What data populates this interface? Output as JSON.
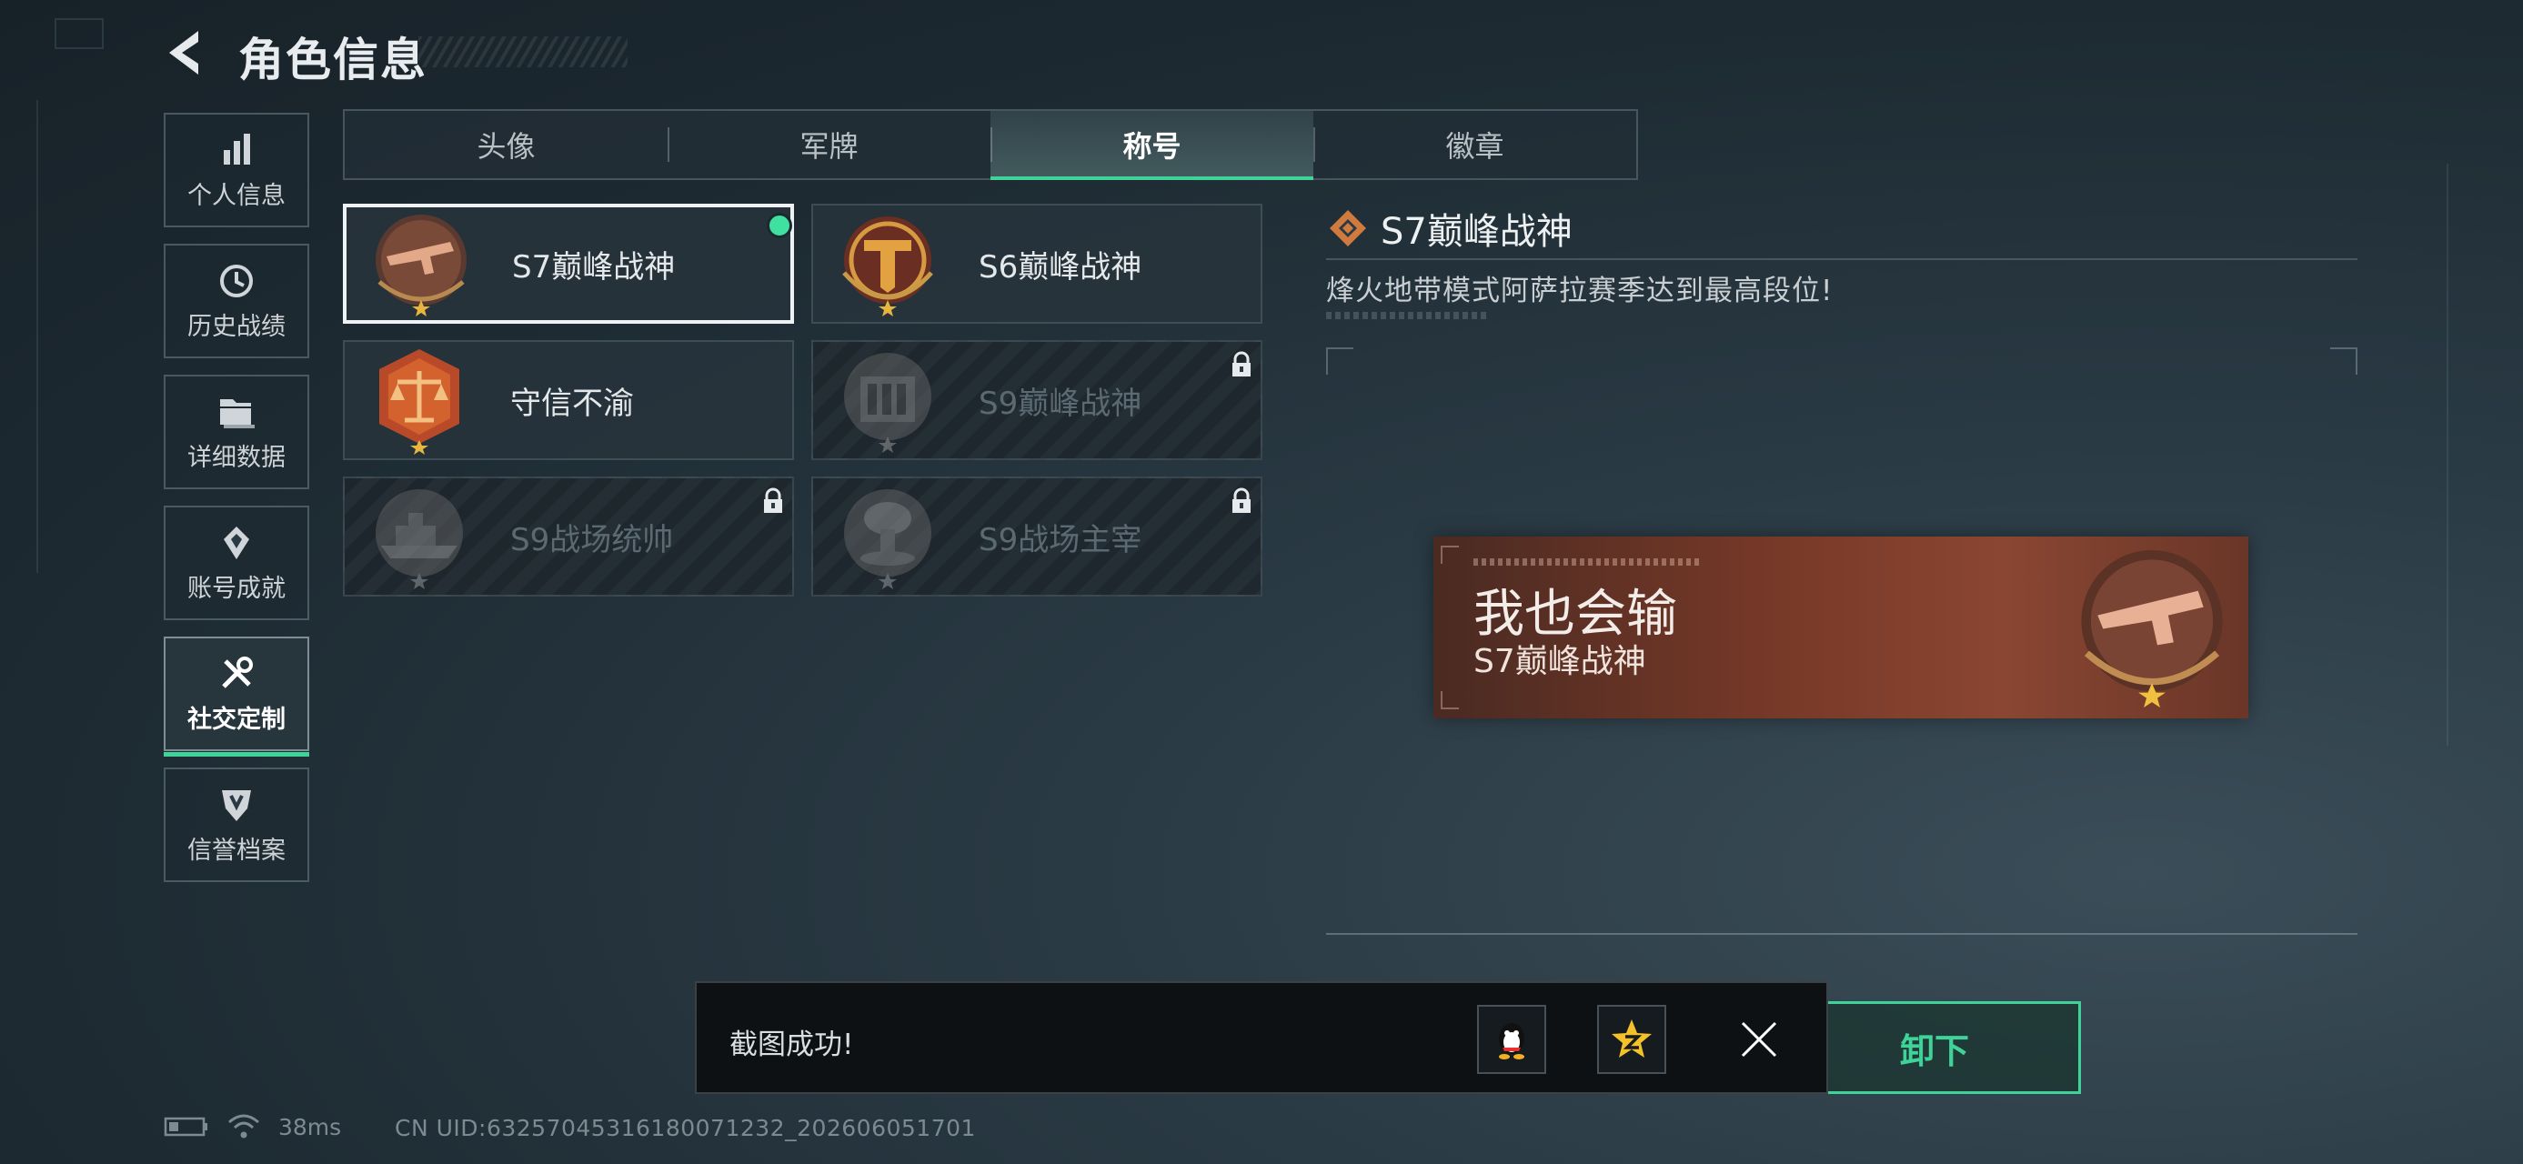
{
  "header": {
    "title": "角色信息"
  },
  "sidebar": {
    "items": [
      {
        "label": "个人信息",
        "icon": "bar-chart-icon"
      },
      {
        "label": "历史战绩",
        "icon": "history-clock-icon"
      },
      {
        "label": "详细数据",
        "icon": "folder-icon"
      },
      {
        "label": "账号成就",
        "icon": "achievement-icon"
      },
      {
        "label": "社交定制",
        "icon": "tools-icon",
        "active": true
      },
      {
        "label": "信誉档案",
        "icon": "credit-shield-icon"
      }
    ]
  },
  "tabs": [
    {
      "label": "头像"
    },
    {
      "label": "军牌"
    },
    {
      "label": "称号",
      "active": true
    },
    {
      "label": "徽章"
    }
  ],
  "titles": [
    {
      "name": "S7巅峰战神",
      "locked": false,
      "selected": true,
      "equipped": true
    },
    {
      "name": "S6巅峰战神",
      "locked": false
    },
    {
      "name": "守信不渝",
      "locked": false
    },
    {
      "name": "S9巅峰战神",
      "locked": true
    },
    {
      "name": "S9战场统帅",
      "locked": true
    },
    {
      "name": "S9战场主宰",
      "locked": true
    }
  ],
  "detail": {
    "title": "S7巅峰战神",
    "description": "烽火地带模式阿萨拉赛季达到最高段位!"
  },
  "preview": {
    "nickname": "我也会输",
    "title": "S7巅峰战神"
  },
  "action": {
    "unequip_label": "卸下"
  },
  "toast": {
    "message": "截图成功!"
  },
  "status": {
    "ping": "38ms",
    "uid": "CN UID:6325704531618007123​2_202606051701"
  },
  "colors": {
    "accent": "#3fd39a",
    "card": "#7a3a28",
    "badge_bronze": "#b0704e"
  }
}
